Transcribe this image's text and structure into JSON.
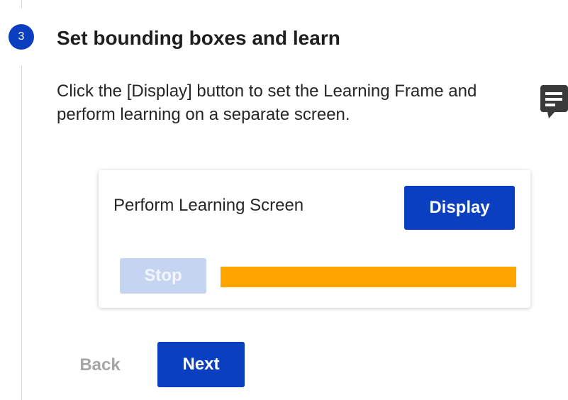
{
  "step": {
    "number": "3",
    "title": "Set bounding boxes and learn",
    "description": "Click the [Display] button to set the Learning Frame and perform learning on a separate screen."
  },
  "card": {
    "label": "Perform Learning Screen",
    "display_label": "Display",
    "stop_label": "Stop",
    "progress": 1.0
  },
  "nav": {
    "back_label": "Back",
    "next_label": "Next"
  },
  "icons": {
    "feedback": "chat-bubble-icon"
  },
  "colors": {
    "primary": "#0a3fbf",
    "progress": "#ffa500",
    "disabled": "#c5d4f0"
  }
}
